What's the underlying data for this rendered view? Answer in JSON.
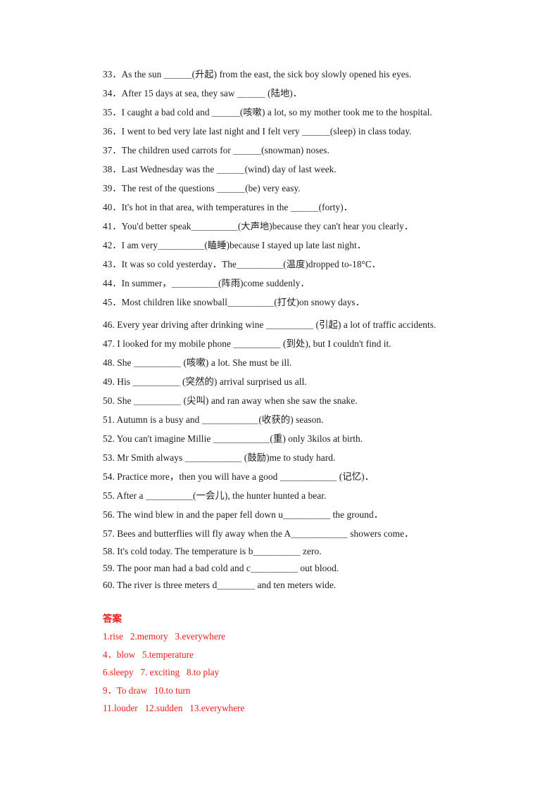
{
  "document": {
    "type": "worksheet",
    "language": "English / Chinese",
    "background_color": "#ffffff",
    "text_color": "#1b1b1b",
    "answer_color": "#ee1c18"
  },
  "exercises": {
    "group_one": [
      "33．As the sun ＿＿＿(升起) from the east, the sick boy slowly opened his eyes.",
      "34．After 15 days at sea, they saw ＿＿＿ (陆地)．",
      "35．I caught a bad cold and ＿＿＿(咳嗽) a lot, so my mother took me to the hospital.",
      "36．I went to bed very late last night and I felt very ＿＿＿(sleep) in class today.",
      "37．The children used carrots for ＿＿＿(snowman) noses.",
      "38．Last Wednesday was the ＿＿＿(wind) day of last week.",
      "39．The rest of the questions ＿＿＿(be) very easy.",
      "40．It's hot in that area, with temperatures in the ＿＿＿(forty)．",
      "41．You'd better speak＿＿＿＿＿(大声地)because they can't hear you clearly．",
      "42．I am very＿＿＿＿＿(瞌睡)because I stayed up late last night．",
      "43．It was so cold yesterday．The＿＿＿＿＿(温度)dropped to-18°C．",
      "44．In summer，＿＿＿＿＿(阵雨)come suddenly．",
      "45．Most children like snowball＿＿＿＿＿(打仗)on snowy days．"
    ],
    "group_two": [
      "46. Every year driving after drinking wine ＿＿＿＿＿ (引起) a lot of traffic accidents.",
      "47. I looked for my mobile phone ＿＿＿＿＿ (到处), but I couldn't find it.",
      "48. She ＿＿＿＿＿ (咳嗽) a lot. She must be ill.",
      "49. His ＿＿＿＿＿ (突然的) arrival surprised us all.",
      "50. She ＿＿＿＿＿ (尖叫) and ran away when she saw the snake.",
      "51. Autumn is a busy and ＿＿＿＿＿＿(收获的) season.",
      "52. You can't imagine Millie ＿＿＿＿＿＿(重) only 3kilos at birth.",
      "53. Mr Smith always ＿＿＿＿＿＿ (鼓励)me to study hard.",
      "54. Practice more，then you will have a good ＿＿＿＿＿＿ (记忆)．",
      "55. After a ＿＿＿＿＿(一会儿), the hunter hunted a bear.",
      "56. The wind blew in and the paper fell down u＿＿＿＿＿ the ground．",
      "57. Bees and butterflies will fly away when the A＿＿＿＿＿＿ showers come．",
      "58. It's cold today. The temperature is b＿＿＿＿＿ zero.",
      "59. The poor man had a bad cold and c＿＿＿＿＿ out blood.",
      "60. The river is three meters d＿＿＿＿ and ten meters wide."
    ]
  },
  "answers": {
    "title": "答案",
    "lines": [
      "1.rise   2.memory   3.everywhere",
      "4．blow   5.temperature",
      "6.sleepy   7. exciting   8.to play",
      "9．To draw   10.to turn",
      "11.louder   12.sudden   13.everywhere"
    ]
  }
}
